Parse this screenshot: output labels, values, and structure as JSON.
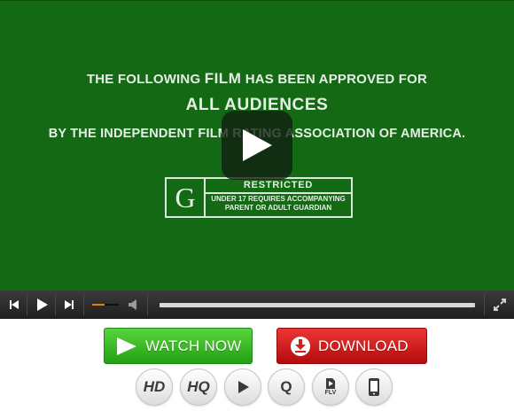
{
  "video": {
    "line1_pre": "THE FOLLOWING",
    "line1_film": "FILM",
    "line1_post": "HAS BEEN APPROVED FOR",
    "line2": "ALL AUDIENCES",
    "line3": "BY THE INDEPENDENT FILM RATING ASSOCIATION OF AMERICA.",
    "rating": {
      "letter": "G",
      "title": "RESTRICTED",
      "desc_line1": "UNDER 17 REQUIRES ACCOMPANYING",
      "desc_line2": "PARENT OR ADULT GUARDIAN"
    },
    "background_color": "#146914"
  },
  "controls": {
    "icons": [
      "skip-back-icon",
      "play-icon",
      "skip-forward-icon",
      "volume-icon",
      "fullscreen-icon"
    ],
    "volume_level": 0.45,
    "seek_progress": 0.0,
    "accent_color": "#e87c12"
  },
  "actions": {
    "watch_label": "WATCH NOW",
    "download_label": "DOWNLOAD",
    "watch_color": "#2fb51f",
    "download_color": "#d81d1d"
  },
  "formats": {
    "hd_label": "HD",
    "hq_label": "HQ",
    "q_label": "Q",
    "flv_label": "FLV"
  }
}
